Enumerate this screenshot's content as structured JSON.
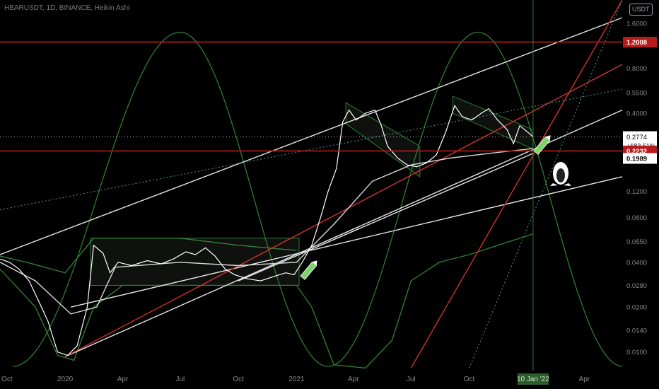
{
  "header": {
    "symbol_line": "HBARUSDT, 1D, BINANCE, Heikin Ashi",
    "price_unit": "USDT"
  },
  "colors": {
    "background": "#000000",
    "price_line": "#ffffff",
    "horizontal_level": "#b71c1c",
    "red_trendline": "#d32f2f",
    "white_trendline": "#e6e6e6",
    "green_curve": "#2e7d32",
    "teal_dotted": "#4a9a9a",
    "current_label_bg": "#ffffff",
    "level_label_bg": "#b71c1c",
    "marker_green": "#7fd36b"
  },
  "icons": [
    "penguin-icon",
    "pencil-icon"
  ],
  "chart_data": {
    "type": "line",
    "title": "",
    "subtitle": "",
    "xlabel": "",
    "ylabel": "",
    "y_scale": "log",
    "grid": false,
    "legend": "none",
    "x_range": [
      "2019-09-20",
      "2022-05-31"
    ],
    "ylim": [
      0.0075,
      2.3
    ],
    "x_ticks": [
      {
        "date": "2019-10-01",
        "label": "Oct"
      },
      {
        "date": "2020-01-01",
        "label": "2020"
      },
      {
        "date": "2020-04-01",
        "label": "Apr"
      },
      {
        "date": "2020-07-01",
        "label": "Jul"
      },
      {
        "date": "2020-10-01",
        "label": "Oct"
      },
      {
        "date": "2021-01-01",
        "label": "2021"
      },
      {
        "date": "2021-04-01",
        "label": "Apr"
      },
      {
        "date": "2021-07-01",
        "label": "Jul"
      },
      {
        "date": "2021-10-01",
        "label": "Oct"
      },
      {
        "date": "2022-04-01",
        "label": "Apr"
      }
    ],
    "cursor_date_label": "10 Jan '22",
    "cursor_date": "2022-01-10",
    "y_ticks": [
      {
        "value": 1.6,
        "label": "1.6000"
      },
      {
        "value": 0.8,
        "label": "0.8000"
      },
      {
        "value": 0.55,
        "label": "0.5500"
      },
      {
        "value": 0.4,
        "label": "0.4000"
      },
      {
        "value": 0.12,
        "label": "0.1200"
      },
      {
        "value": 0.08,
        "label": "0.0800"
      },
      {
        "value": 0.055,
        "label": "0.0550"
      },
      {
        "value": 0.04,
        "label": "0.0400"
      },
      {
        "value": 0.028,
        "label": "0.0280"
      },
      {
        "value": 0.02,
        "label": "0.0200"
      },
      {
        "value": 0.014,
        "label": "0.0140"
      },
      {
        "value": 0.01,
        "label": "0.0100"
      }
    ],
    "price_labels": {
      "level_top": "1.2008",
      "current_price": "0.2774",
      "change_pct": "+683.51%",
      "countdown": "06:41",
      "level_bottom": "0.2232",
      "support": "0.1989"
    },
    "horizontal_levels": [
      {
        "value": 1.2008
      },
      {
        "value": 0.2232
      }
    ],
    "current_price_value": 0.2774,
    "price_series": [
      {
        "x": "2019-09-20",
        "y": 0.042
      },
      {
        "x": "2019-10-05",
        "y": 0.04
      },
      {
        "x": "2019-10-20",
        "y": 0.036
      },
      {
        "x": "2019-11-05",
        "y": 0.03
      },
      {
        "x": "2019-11-20",
        "y": 0.022
      },
      {
        "x": "2019-12-05",
        "y": 0.016
      },
      {
        "x": "2019-12-20",
        "y": 0.01
      },
      {
        "x": "2020-01-05",
        "y": 0.0095
      },
      {
        "x": "2020-01-20",
        "y": 0.011
      },
      {
        "x": "2020-02-05",
        "y": 0.02
      },
      {
        "x": "2020-02-15",
        "y": 0.052
      },
      {
        "x": "2020-03-01",
        "y": 0.046
      },
      {
        "x": "2020-03-12",
        "y": 0.034
      },
      {
        "x": "2020-03-25",
        "y": 0.04
      },
      {
        "x": "2020-04-15",
        "y": 0.038
      },
      {
        "x": "2020-05-10",
        "y": 0.041
      },
      {
        "x": "2020-06-01",
        "y": 0.039
      },
      {
        "x": "2020-06-20",
        "y": 0.042
      },
      {
        "x": "2020-07-10",
        "y": 0.047
      },
      {
        "x": "2020-07-25",
        "y": 0.045
      },
      {
        "x": "2020-08-10",
        "y": 0.05
      },
      {
        "x": "2020-08-25",
        "y": 0.044
      },
      {
        "x": "2020-09-10",
        "y": 0.036
      },
      {
        "x": "2020-09-25",
        "y": 0.033
      },
      {
        "x": "2020-10-15",
        "y": 0.031
      },
      {
        "x": "2020-11-05",
        "y": 0.03
      },
      {
        "x": "2020-11-25",
        "y": 0.032
      },
      {
        "x": "2020-12-15",
        "y": 0.034
      },
      {
        "x": "2020-12-28",
        "y": 0.033
      },
      {
        "x": "2021-01-10",
        "y": 0.04
      },
      {
        "x": "2021-01-25",
        "y": 0.052
      },
      {
        "x": "2021-02-08",
        "y": 0.08
      },
      {
        "x": "2021-02-20",
        "y": 0.12
      },
      {
        "x": "2021-03-05",
        "y": 0.17
      },
      {
        "x": "2021-03-15",
        "y": 0.35
      },
      {
        "x": "2021-03-25",
        "y": 0.42
      },
      {
        "x": "2021-04-05",
        "y": 0.36
      },
      {
        "x": "2021-04-20",
        "y": 0.4
      },
      {
        "x": "2021-05-05",
        "y": 0.42
      },
      {
        "x": "2021-05-15",
        "y": 0.33
      },
      {
        "x": "2021-05-25",
        "y": 0.24
      },
      {
        "x": "2021-06-10",
        "y": 0.2
      },
      {
        "x": "2021-06-25",
        "y": 0.18
      },
      {
        "x": "2021-07-10",
        "y": 0.175
      },
      {
        "x": "2021-07-25",
        "y": 0.185
      },
      {
        "x": "2021-08-10",
        "y": 0.21
      },
      {
        "x": "2021-08-25",
        "y": 0.3
      },
      {
        "x": "2021-09-08",
        "y": 0.45
      },
      {
        "x": "2021-09-20",
        "y": 0.38
      },
      {
        "x": "2021-10-05",
        "y": 0.36
      },
      {
        "x": "2021-10-20",
        "y": 0.4
      },
      {
        "x": "2021-11-01",
        "y": 0.43
      },
      {
        "x": "2021-11-15",
        "y": 0.36
      },
      {
        "x": "2021-11-30",
        "y": 0.31
      },
      {
        "x": "2021-12-10",
        "y": 0.25
      },
      {
        "x": "2021-12-20",
        "y": 0.33
      },
      {
        "x": "2022-01-01",
        "y": 0.3
      },
      {
        "x": "2022-01-10",
        "y": 0.2774
      }
    ],
    "ma_series": [
      {
        "x": "2019-09-20",
        "y": 0.04
      },
      {
        "x": "2019-11-15",
        "y": 0.03
      },
      {
        "x": "2020-01-10",
        "y": 0.018
      },
      {
        "x": "2020-02-20",
        "y": 0.02
      },
      {
        "x": "2020-03-20",
        "y": 0.037
      },
      {
        "x": "2020-07-01",
        "y": 0.04
      },
      {
        "x": "2020-10-01",
        "y": 0.038
      },
      {
        "x": "2021-01-01",
        "y": 0.04
      },
      {
        "x": "2021-03-01",
        "y": 0.072
      },
      {
        "x": "2021-05-01",
        "y": 0.14
      },
      {
        "x": "2021-07-01",
        "y": 0.18
      },
      {
        "x": "2021-09-01",
        "y": 0.2
      },
      {
        "x": "2021-11-01",
        "y": 0.215
      },
      {
        "x": "2022-01-10",
        "y": 0.232
      }
    ],
    "band_upper": [
      {
        "x": "2019-09-20",
        "y": 0.044
      },
      {
        "x": "2019-11-01",
        "y": 0.04
      },
      {
        "x": "2020-01-01",
        "y": 0.034
      },
      {
        "x": "2020-02-15",
        "y": 0.058
      },
      {
        "x": "2020-04-01",
        "y": 0.058
      },
      {
        "x": "2020-07-01",
        "y": 0.058
      },
      {
        "x": "2020-10-01",
        "y": 0.052
      },
      {
        "x": "2021-01-01",
        "y": 0.048
      }
    ],
    "band_lower": [
      {
        "x": "2019-09-20",
        "y": 0.036
      },
      {
        "x": "2019-11-15",
        "y": 0.02
      },
      {
        "x": "2019-12-20",
        "y": 0.0095
      },
      {
        "x": "2020-01-15",
        "y": 0.0088
      },
      {
        "x": "2020-02-15",
        "y": 0.02
      },
      {
        "x": "2020-04-01",
        "y": 0.028
      },
      {
        "x": "2020-10-01",
        "y": 0.028
      },
      {
        "x": "2021-01-01",
        "y": 0.028
      },
      {
        "x": "2021-01-25",
        "y": 0.02
      },
      {
        "x": "2021-03-01",
        "y": 0.0082
      },
      {
        "x": "2021-04-20",
        "y": 0.0078
      },
      {
        "x": "2021-06-01",
        "y": 0.012
      },
      {
        "x": "2021-07-01",
        "y": 0.03
      },
      {
        "x": "2021-08-15",
        "y": 0.04
      },
      {
        "x": "2021-10-01",
        "y": 0.045
      },
      {
        "x": "2022-01-10",
        "y": 0.062
      }
    ],
    "sine_cycle": {
      "peaks": [
        "2020-07-01",
        "2021-10-15"
      ],
      "troughs": [
        "2019-10-10",
        "2021-02-20",
        "2022-06-01"
      ],
      "high": 1.4,
      "low": 0.008
    },
    "white_trendlines": [
      {
        "from": {
          "x": "2019-09-20",
          "y": 0.045
        },
        "to": {
          "x": "2022-05-31",
          "y": 1.75
        }
      },
      {
        "from": {
          "x": "2020-01-01",
          "y": 0.0093
        },
        "to": {
          "x": "2022-05-31",
          "y": 0.42
        }
      },
      {
        "from": {
          "x": "2020-01-10",
          "y": 0.02
        },
        "to": {
          "x": "2022-05-31",
          "y": 0.15
        }
      },
      {
        "from": {
          "x": "2020-10-01",
          "y": 0.03
        },
        "to": {
          "x": "2022-01-10",
          "y": 0.215
        }
      }
    ],
    "red_trendlines": [
      {
        "from": {
          "x": "2020-01-01",
          "y": 0.0093
        },
        "to": {
          "x": "2022-05-31",
          "y": 0.85
        }
      },
      {
        "from": {
          "x": "2021-07-01",
          "y": 0.0078
        },
        "to": {
          "x": "2022-05-31",
          "y": 2.3
        }
      }
    ],
    "teal_dotted_lines": [
      {
        "from": {
          "x": "2019-09-20",
          "y": 0.09
        },
        "to": {
          "x": "2022-05-31",
          "y": 0.58
        }
      },
      {
        "from": {
          "x": "2021-10-01",
          "y": 0.0078
        },
        "to": {
          "x": "2022-05-31",
          "y": 2.3
        }
      }
    ],
    "channels": [
      {
        "from": "2020-02-10",
        "to": "2021-01-05",
        "top": 0.058,
        "bottom": 0.028
      },
      {
        "from": "2021-03-20",
        "to": "2021-07-15",
        "top_start": 0.47,
        "top_end": 0.24,
        "bottom_start": 0.34,
        "bottom_end": 0.15
      },
      {
        "from": "2021-09-05",
        "to": "2022-01-10",
        "top_start": 0.52,
        "top_end": 0.31,
        "bottom_start": 0.4,
        "bottom_end": 0.23
      }
    ]
  }
}
